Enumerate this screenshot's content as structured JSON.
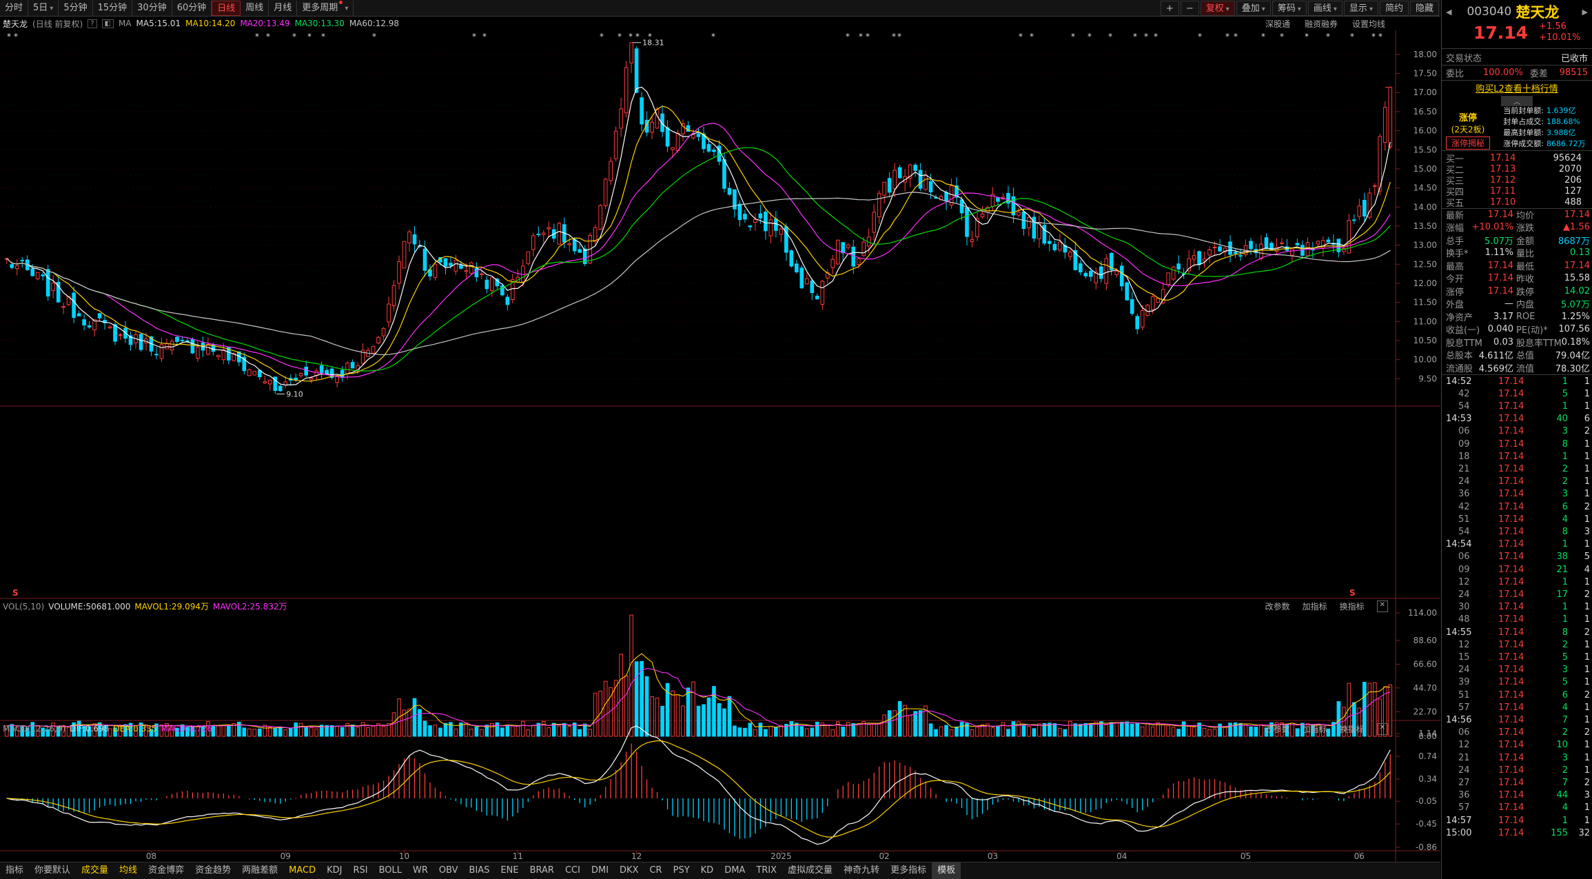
{
  "toolbar": {
    "periods": [
      "分时",
      "5日",
      "5分钟",
      "15分钟",
      "30分钟",
      "60分钟",
      "日线",
      "周线",
      "月线",
      "更多周期"
    ],
    "active_period": "日线",
    "right_buttons": [
      "+",
      "−",
      "复权",
      "叠加",
      "筹码",
      "画线",
      "显示",
      "简约",
      "隐藏"
    ],
    "sub_links": [
      "深股通",
      "融资融券",
      "设置均线"
    ]
  },
  "info": {
    "name": "楚天龙",
    "desc": "(日线 前复权)",
    "ma_label": "MA",
    "ma5": "MA5:15.01",
    "ma10": "MA10:14.20",
    "ma20": "MA20:13.49",
    "ma30": "MA30:13.30",
    "ma60": "MA60:12.98"
  },
  "colors": {
    "up": "#ff3b3b",
    "down": "#00d4ff",
    "ma5": "#ffffff",
    "ma10": "#ffd200",
    "ma20": "#ff30ff",
    "ma30": "#00dd00",
    "ma60": "#c8c8c8",
    "dif": "#ffffff",
    "dea": "#ffd200"
  },
  "annotations": {
    "high": "18.31",
    "low": "9.10",
    "s_mark": "S"
  },
  "vol": {
    "header": [
      "VOL(5,10)",
      "VOLUME:50681.000",
      "MAVOL1:29.094万",
      "MAVOL2:25.832万"
    ],
    "tools": [
      "改参数",
      "加指标",
      "换指标"
    ],
    "axis": [
      "114.00",
      "88.60",
      "66.60",
      "44.70",
      "22.70",
      "0.00"
    ]
  },
  "macd": {
    "header": [
      "MACD(12,26,9)",
      "DIF:0.698",
      "DEA:0.335",
      "MACD:0.726"
    ],
    "tools": [
      "改参数",
      "加指标",
      "换指标"
    ],
    "axis": [
      "1.14",
      "0.74",
      "0.34",
      "-0.05",
      "-0.45",
      "-0.86"
    ]
  },
  "chart_data": {
    "type": "candlestick",
    "price_axis": [
      "18.00",
      "17.50",
      "17.00",
      "16.50",
      "16.00",
      "15.50",
      "15.00",
      "14.50",
      "14.00",
      "13.50",
      "13.00",
      "12.50",
      "12.00",
      "11.50",
      "11.00",
      "10.50",
      "10.00",
      "9.50"
    ],
    "x_labels": [
      {
        "label": "08",
        "i": 28
      },
      {
        "label": "09",
        "i": 54
      },
      {
        "label": "10",
        "i": 77
      },
      {
        "label": "11",
        "i": 99
      },
      {
        "label": "12",
        "i": 122
      },
      {
        "label": "2025",
        "i": 150
      },
      {
        "label": "02",
        "i": 170
      },
      {
        "label": "03",
        "i": 191
      },
      {
        "label": "04",
        "i": 216
      },
      {
        "label": "05",
        "i": 240
      },
      {
        "label": "06",
        "i": 262
      }
    ],
    "anchors": [
      [
        0,
        12.6
      ],
      [
        6,
        12.1
      ],
      [
        14,
        11.2
      ],
      [
        22,
        10.6
      ],
      [
        30,
        10.3
      ],
      [
        38,
        10.4
      ],
      [
        44,
        10.0
      ],
      [
        50,
        9.5
      ],
      [
        52,
        9.15
      ],
      [
        58,
        9.7
      ],
      [
        64,
        9.6
      ],
      [
        68,
        10.0
      ],
      [
        72,
        10.4
      ],
      [
        75,
        12.0
      ],
      [
        78,
        13.5
      ],
      [
        82,
        12.3
      ],
      [
        87,
        12.6
      ],
      [
        92,
        12.2
      ],
      [
        97,
        11.6
      ],
      [
        100,
        12.6
      ],
      [
        104,
        13.6
      ],
      [
        108,
        13.2
      ],
      [
        112,
        12.4
      ],
      [
        115,
        14.2
      ],
      [
        118,
        15.8
      ],
      [
        121,
        18.1
      ],
      [
        123,
        15.9
      ],
      [
        126,
        16.3
      ],
      [
        129,
        15.4
      ],
      [
        132,
        16.2
      ],
      [
        136,
        15.7
      ],
      [
        140,
        14.3
      ],
      [
        144,
        13.4
      ],
      [
        149,
        13.6
      ],
      [
        153,
        12.2
      ],
      [
        157,
        11.7
      ],
      [
        161,
        12.9
      ],
      [
        165,
        12.6
      ],
      [
        170,
        14.6
      ],
      [
        175,
        14.9
      ],
      [
        179,
        14.5
      ],
      [
        183,
        14.4
      ],
      [
        187,
        13.2
      ],
      [
        191,
        14.5
      ],
      [
        195,
        13.9
      ],
      [
        199,
        13.4
      ],
      [
        203,
        13.1
      ],
      [
        207,
        12.6
      ],
      [
        211,
        12.3
      ],
      [
        215,
        12.5
      ],
      [
        219,
        10.8
      ],
      [
        222,
        11.6
      ],
      [
        226,
        12.3
      ],
      [
        230,
        12.6
      ],
      [
        234,
        13.1
      ],
      [
        238,
        12.6
      ],
      [
        242,
        13.0
      ],
      [
        246,
        12.8
      ],
      [
        250,
        12.8
      ],
      [
        254,
        12.9
      ],
      [
        258,
        12.8
      ],
      [
        261,
        13.9
      ],
      [
        264,
        14.1
      ],
      [
        268,
        17.14
      ]
    ]
  },
  "right": {
    "code": "003040",
    "name": "楚天龙",
    "price": "17.14",
    "change": "+1.56",
    "pct": "+10.01%",
    "status_label": "交易状态",
    "status_value": "已收市",
    "webi_label": "委比",
    "webi_value": "100.00%",
    "wecha_label": "委差",
    "wecha_value": "98515",
    "l2_link": "购买L2查看十档行情",
    "zt_title": "涨停",
    "zt_sub": "(2天2板)",
    "zt_tag": "涨停揭秘",
    "zt_items": [
      [
        "当前封单额:",
        "1.639亿"
      ],
      [
        "封单占成交:",
        "188.68%"
      ],
      [
        "最高封单额:",
        "3.988亿"
      ],
      [
        "涨停成交额:",
        "8686.72万"
      ]
    ],
    "buys": [
      [
        "买一",
        "17.14",
        "95624"
      ],
      [
        "买二",
        "17.13",
        "2070"
      ],
      [
        "买三",
        "17.12",
        "206"
      ],
      [
        "买四",
        "17.11",
        "127"
      ],
      [
        "买五",
        "17.10",
        "488"
      ]
    ],
    "stats": [
      [
        "最新",
        "17.14",
        "均价",
        "17.14"
      ],
      [
        "涨幅",
        "+10.01%",
        "涨跌",
        "▲1.56"
      ],
      [
        "总手",
        "5.07万",
        "金额",
        "8687万"
      ],
      [
        "换手*",
        "1.11%",
        "量比",
        "0.13"
      ],
      [
        "最高",
        "17.14",
        "最低",
        "17.14"
      ],
      [
        "今开",
        "17.14",
        "昨收",
        "15.58"
      ],
      [
        "涨停",
        "17.14",
        "跌停",
        "14.02"
      ],
      [
        "外盘",
        "—",
        "内盘",
        "5.07万"
      ],
      [
        "净资产",
        "3.17",
        "ROE",
        "1.25%"
      ],
      [
        "收益(一)",
        "0.040",
        "PE(动)*",
        "107.56"
      ],
      [
        "股息TTM",
        "0.03",
        "股息率TTM",
        "0.18%"
      ],
      [
        "总股本",
        "4.611亿",
        "总值",
        "79.04亿"
      ],
      [
        "流通股",
        "4.569亿",
        "流值",
        "78.30亿"
      ]
    ],
    "ticks": [
      [
        "14:52",
        "17.14",
        "1",
        "1"
      ],
      [
        "42",
        "17.14",
        "5",
        "1"
      ],
      [
        "54",
        "17.14",
        "1",
        "1"
      ],
      [
        "14:53",
        "17.14",
        "40",
        "6"
      ],
      [
        "06",
        "17.14",
        "3",
        "2"
      ],
      [
        "09",
        "17.14",
        "8",
        "1"
      ],
      [
        "18",
        "17.14",
        "1",
        "1"
      ],
      [
        "21",
        "17.14",
        "2",
        "1"
      ],
      [
        "24",
        "17.14",
        "2",
        "1"
      ],
      [
        "36",
        "17.14",
        "3",
        "1"
      ],
      [
        "42",
        "17.14",
        "6",
        "2"
      ],
      [
        "51",
        "17.14",
        "4",
        "1"
      ],
      [
        "54",
        "17.14",
        "8",
        "3"
      ],
      [
        "14:54",
        "17.14",
        "1",
        "1"
      ],
      [
        "06",
        "17.14",
        "38",
        "5"
      ],
      [
        "09",
        "17.14",
        "21",
        "4"
      ],
      [
        "12",
        "17.14",
        "1",
        "1"
      ],
      [
        "24",
        "17.14",
        "17",
        "2"
      ],
      [
        "30",
        "17.14",
        "1",
        "1"
      ],
      [
        "48",
        "17.14",
        "1",
        "1"
      ],
      [
        "14:55",
        "17.14",
        "8",
        "2"
      ],
      [
        "12",
        "17.14",
        "2",
        "1"
      ],
      [
        "15",
        "17.14",
        "5",
        "1"
      ],
      [
        "24",
        "17.14",
        "3",
        "1"
      ],
      [
        "39",
        "17.14",
        "5",
        "1"
      ],
      [
        "51",
        "17.14",
        "6",
        "2"
      ],
      [
        "57",
        "17.14",
        "4",
        "1"
      ],
      [
        "14:56",
        "17.14",
        "7",
        "1"
      ],
      [
        "06",
        "17.14",
        "2",
        "2"
      ],
      [
        "12",
        "17.14",
        "10",
        "1"
      ],
      [
        "21",
        "17.14",
        "3",
        "1"
      ],
      [
        "24",
        "17.14",
        "2",
        "1"
      ],
      [
        "27",
        "17.14",
        "7",
        "2"
      ],
      [
        "36",
        "17.14",
        "44",
        "3"
      ],
      [
        "57",
        "17.14",
        "4",
        "1"
      ],
      [
        "14:57",
        "17.14",
        "1",
        "1"
      ],
      [
        "15:00",
        "17.14",
        "155",
        "32"
      ]
    ]
  },
  "bottom": {
    "tabs": [
      "指标",
      "你要默认",
      "成交量",
      "均线",
      "资金博弈",
      "资金趋势",
      "两融差额",
      "MACD",
      "KDJ",
      "RSI",
      "BOLL",
      "WR",
      "OBV",
      "BIAS",
      "ENE",
      "BRAR",
      "CCI",
      "DMI",
      "DKX",
      "CR",
      "PSY",
      "KD",
      "DMA",
      "TRIX",
      "虚拟成交量",
      "神奇九转",
      "更多指标",
      "模板"
    ],
    "highlighted": [
      "成交量",
      "均线",
      "MACD"
    ]
  }
}
